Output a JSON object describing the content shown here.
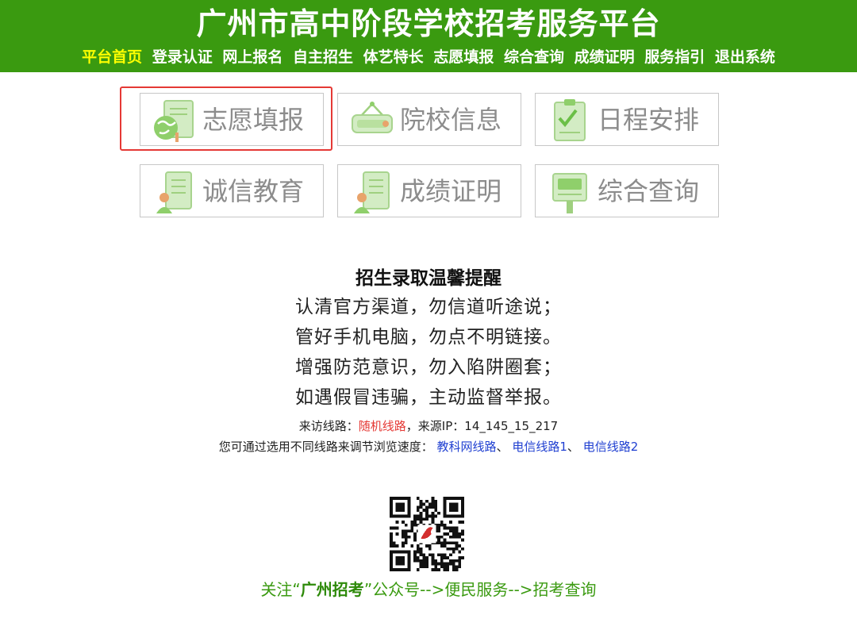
{
  "header": {
    "title": "广州市高中阶段学校招考服务平台",
    "nav": [
      "平台首页",
      "登录认证",
      "网上报名",
      "自主招生",
      "体艺特长",
      "志愿填报",
      "综合查询",
      "成绩证明",
      "服务指引",
      "退出系统"
    ],
    "active_index": 0
  },
  "tiles": {
    "t1": {
      "label": "志愿填报",
      "icon": "globe-document-icon"
    },
    "t2": {
      "label": "院校信息",
      "icon": "school-sign-icon"
    },
    "t3": {
      "label": "日程安排",
      "icon": "checklist-icon"
    },
    "t4": {
      "label": "诚信教育",
      "icon": "person-document-icon"
    },
    "t5": {
      "label": "成绩证明",
      "icon": "person-document-icon"
    },
    "t6": {
      "label": "综合查询",
      "icon": "search-board-icon"
    }
  },
  "notice": {
    "title": "招生录取温馨提醒",
    "lines": [
      "认清官方渠道，勿信道听途说；",
      "管好手机电脑，勿点不明链接。",
      "增强防范意识，勿入陷阱圈套；",
      "如遇假冒违骗，主动监督举报。"
    ]
  },
  "route": {
    "prefix": "来访线路：",
    "value": "随机线路",
    "ip_prefix": "，来源IP：",
    "ip": "14_145_15_217"
  },
  "speed": {
    "prefix": "您可通过选用不同线路来调节浏览速度：",
    "links": [
      "教科网线路",
      "电信线路1",
      "电信线路2"
    ],
    "separator": "、"
  },
  "footer": {
    "before": "关注“",
    "account": "广州招考",
    "after": "”公众号-->便民服务-->招考查询"
  },
  "colors": {
    "header_bg": "#3a9a10",
    "nav_active": "#ffff00",
    "highlight": "#e53935",
    "link": "#1f3fd1",
    "footer_text": "#3a9a10"
  }
}
